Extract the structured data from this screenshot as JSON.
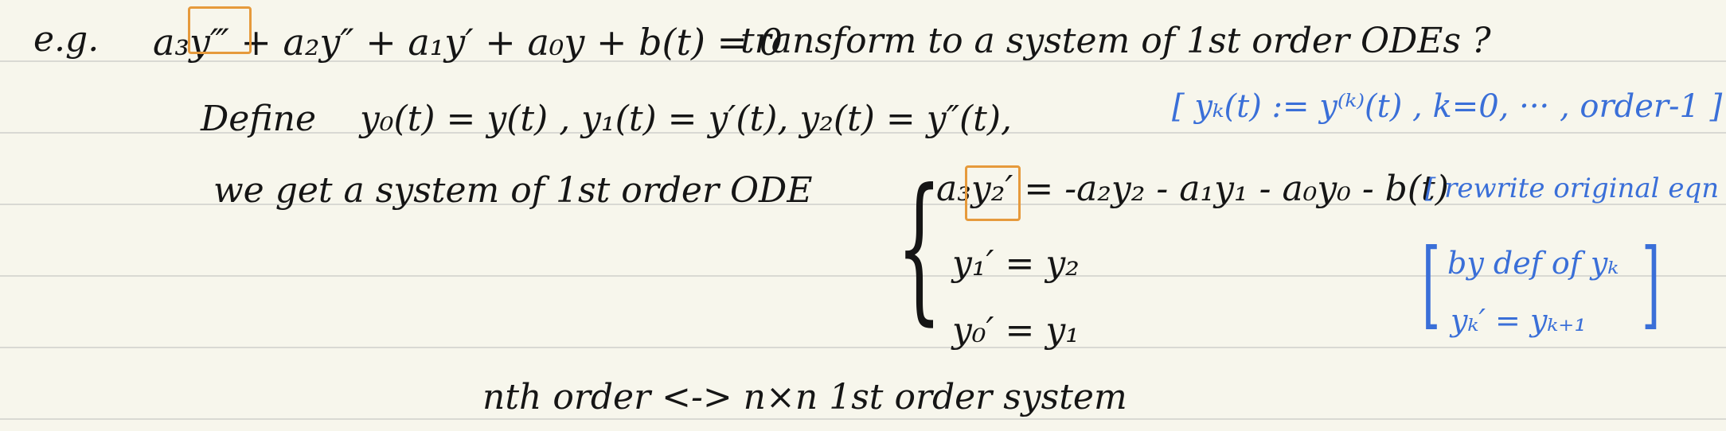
{
  "note": {
    "eg_label": "e.g.",
    "equation": "a₃y‴ + a₂y″ + a₁y′ + a₀y + b(t) = 0",
    "question": "transform to a system of 1st order ODEs ?",
    "define_label": "Define",
    "definitions": "y₀(t) = y(t) ,   y₁(t) = y′(t),   y₂(t) = y″(t),",
    "def_comment": "[ yₖ(t) := y⁽ᵏ⁾(t) ,  k=0, ··· , order-1 ]",
    "get_system": "we get a system of 1st order ODE",
    "sys_eq1": "a₃y₂′ = -a₂y₂ - a₁y₁ - a₀y₀ - b(t)",
    "sys_eq2": "y₁′ = y₂",
    "sys_eq3": "y₀′ = y₁",
    "rewrite_comment": "[ rewrite original eqn ]",
    "bydef_comment_line1": "by def of yₖ",
    "bydef_comment_line2": "yₖ′ = yₖ₊₁",
    "conclusion": "nth order <-> n×n 1st order system"
  },
  "colors": {
    "ink": "#151515",
    "comment_blue": "#3a6fd8",
    "highlight_orange": "#e69a3c",
    "paper": "#f7f6ec",
    "rule_line": "#d9d9d3"
  }
}
